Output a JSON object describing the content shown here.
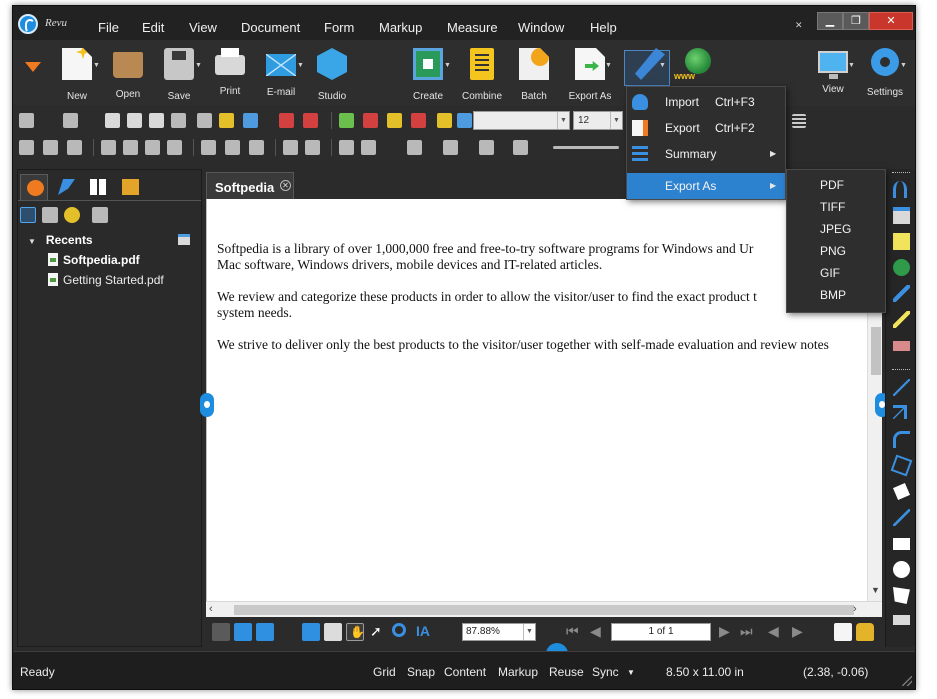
{
  "app": {
    "name": "Revu"
  },
  "menu": [
    "File",
    "Edit",
    "View",
    "Document",
    "Form",
    "Markup",
    "Measure",
    "Window",
    "Help"
  ],
  "ribbon": {
    "new": "New",
    "open": "Open",
    "save": "Save",
    "print": "Print",
    "email": "E-mail",
    "studio": "Studio",
    "create": "Create",
    "combine": "Combine",
    "batch": "Batch",
    "export_as": "Export As",
    "www": "www",
    "view": "View",
    "settings": "Settings"
  },
  "toolbar": {
    "font_size": "12"
  },
  "panel": {
    "recents_label": "Recents",
    "files": [
      "Softpedia.pdf",
      "Getting Started.pdf"
    ]
  },
  "document": {
    "tab_label": "Softpedia",
    "paragraphs": [
      "Softpedia is a library of over 1,000,000 free and free-to-try software programs for Windows and Ur",
      "Mac software, Windows drivers, mobile devices and IT-related articles.",
      "We review and categorize these products in order to allow the visitor/user to find the exact product t",
      "system needs.",
      "We strive to deliver only the best products to the visitor/user together with self-made evaluation and review notes"
    ]
  },
  "dropdown": {
    "items": [
      {
        "label": "Import",
        "shortcut": "Ctrl+F3"
      },
      {
        "label": "Export",
        "shortcut": "Ctrl+F2"
      },
      {
        "label": "Summary",
        "shortcut": ""
      },
      {
        "label": "Export As",
        "shortcut": ""
      }
    ],
    "submenu": [
      "PDF",
      "TIFF",
      "JPEG",
      "PNG",
      "GIF",
      "BMP"
    ]
  },
  "navbar": {
    "zoom": "87.88%",
    "page": "1 of 1"
  },
  "status": {
    "ready": "Ready",
    "items": [
      "Grid",
      "Snap",
      "Content",
      "Markup",
      "Reuse",
      "Sync"
    ],
    "page_size": "8.50 x 11.00 in",
    "coords": "(2.38, -0.06)"
  },
  "colors": {
    "accent": "#1e8de0",
    "highlight": "#2d82d0",
    "chrome": "#2b2b2b"
  },
  "icons": [
    "app-logo-icon",
    "new-icon",
    "open-folder-icon",
    "save-icon",
    "print-icon",
    "email-icon",
    "studio-icon",
    "create-icon",
    "combine-icon",
    "batch-icon",
    "export-as-icon",
    "markup-tools-icon",
    "www-globe-icon",
    "view-monitor-icon",
    "settings-gear-icon"
  ]
}
